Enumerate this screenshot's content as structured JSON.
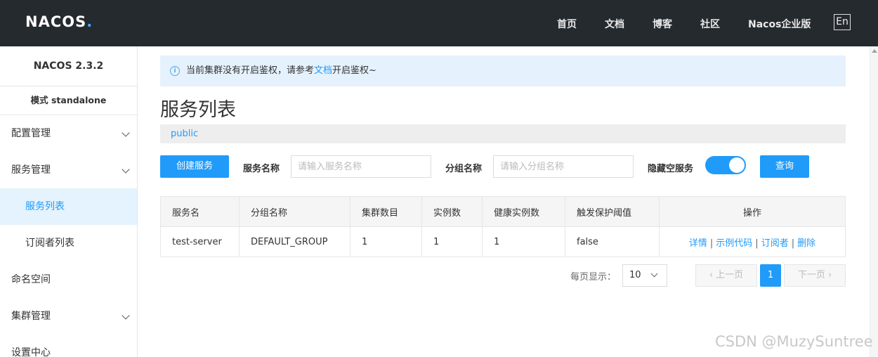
{
  "header": {
    "logo_main": "NACOS",
    "logo_dot": ".",
    "nav": [
      "首页",
      "文档",
      "博客",
      "社区",
      "Nacos企业版"
    ],
    "lang": "En"
  },
  "sidebar": {
    "version": "NACOS 2.3.2",
    "mode": "模式 standalone",
    "items": [
      {
        "label": "配置管理"
      },
      {
        "label": "服务管理"
      },
      {
        "label": "服务列表"
      },
      {
        "label": "订阅者列表"
      },
      {
        "label": "命名空间"
      },
      {
        "label": "集群管理"
      },
      {
        "label": "设置中心"
      }
    ]
  },
  "notice": {
    "prefix": "当前集群没有开启鉴权，请参考",
    "link": "文档",
    "suffix": "开启鉴权~"
  },
  "page": {
    "title": "服务列表",
    "namespace": "public"
  },
  "filters": {
    "create_label": "创建服务",
    "service_name_label": "服务名称",
    "service_name_placeholder": "请输入服务名称",
    "group_name_label": "分组名称",
    "group_name_placeholder": "请输入分组名称",
    "hide_empty_label": "隐藏空服务",
    "query_label": "查询"
  },
  "table": {
    "headers": [
      "服务名",
      "分组名称",
      "集群数目",
      "实例数",
      "健康实例数",
      "触发保护阈值",
      "操作"
    ],
    "rows": [
      {
        "name": "test-server",
        "group": "DEFAULT_GROUP",
        "clusters": "1",
        "instances": "1",
        "healthy": "1",
        "threshold": "false",
        "ops": [
          "详情",
          "示例代码",
          "订阅者",
          "删除"
        ],
        "sep": "|"
      }
    ]
  },
  "pagination": {
    "per_page_label": "每页显示：",
    "per_page": "10",
    "prev": "上一页",
    "current": "1",
    "next": "下一页"
  },
  "watermark": "CSDN @MuzySuntree",
  "colors": {
    "accent": "#209bfa",
    "header_bg": "#252a2f",
    "active_bg": "#e4f3fe"
  }
}
